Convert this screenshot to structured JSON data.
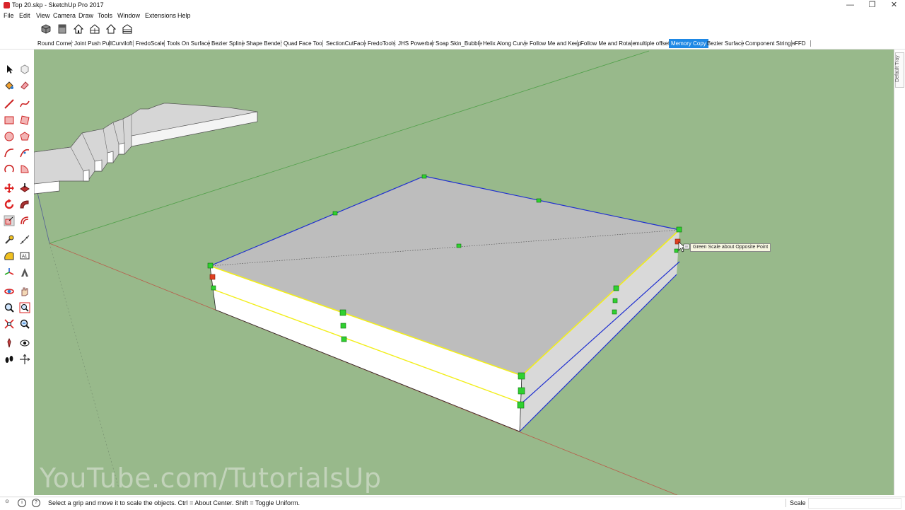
{
  "window": {
    "title": "Top 20.skp - SketchUp Pro 2017",
    "controls": [
      "—",
      "❐",
      "✕"
    ]
  },
  "menu": [
    "File",
    "Edit",
    "View",
    "Camera",
    "Draw",
    "Tools",
    "Window",
    "Extensions",
    "Help"
  ],
  "view_toolbar": {
    "icons": [
      "iso-view-icon",
      "top-view-icon",
      "front-view-icon",
      "right-view-icon",
      "back-view-icon",
      "left-view-icon"
    ]
  },
  "plugin_toolbar": {
    "items": [
      "Round Corner",
      "Joint Push Pull",
      "Curviloft",
      "FredoScale",
      "Tools On Surface",
      "Bezier Spline",
      "Shape Bender",
      "Quad Face Tool",
      "SectionCutFace",
      "FredoTools",
      "JHS Powerbar",
      "Soap Skin_Bubble",
      "Helix Along Curve",
      "Follow Me and Keep",
      "Follow Me and Rotate",
      "multiple offset",
      "Memory Copy",
      "Bezier Surface",
      "Component Stringer",
      "FFD"
    ],
    "active": "Memory Copy",
    "accent_color": "#1e88e5"
  },
  "left_toolbar": {
    "tools": [
      "select-icon",
      "component-icon",
      "paint-bucket-icon",
      "eraser-icon",
      "line-icon",
      "freehand-icon",
      "rectangle-icon",
      "rotated-rectangle-icon",
      "circle-icon",
      "polygon-icon",
      "arc-icon",
      "two-point-arc-icon",
      "three-point-arc-icon",
      "pie-icon",
      "move-icon",
      "push-pull-icon",
      "rotate-icon",
      "follow-me-icon",
      "scale-icon",
      "offset-icon",
      "tape-measure-icon",
      "dimension-icon",
      "protractor-icon",
      "text-icon",
      "axes-icon",
      "3d-text-icon",
      "orbit-icon",
      "pan-icon",
      "zoom-icon",
      "zoom-window-icon",
      "zoom-extents-icon",
      "previous-view-icon",
      "position-camera-icon",
      "look-around-icon",
      "walk-icon",
      "section-plane-icon"
    ]
  },
  "viewport": {
    "background": "#98b98b",
    "tooltip": "Green Scale about Opposite Point",
    "watermark": "YouTube.com/TutorialsUp"
  },
  "right_tray": {
    "label": "Default Tray"
  },
  "statusbar": {
    "icons": [
      "geo-location-icon",
      "credits-icon",
      "help-icon"
    ],
    "message": "Select a grip and move it to scale the objects. Ctrl = About Center. Shift = Toggle Uniform.",
    "measurements_label": "Scale",
    "measurements_value": ""
  }
}
